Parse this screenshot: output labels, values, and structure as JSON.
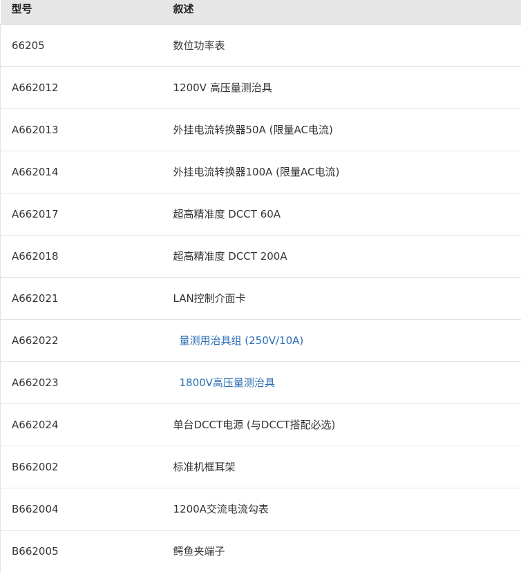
{
  "table": {
    "headers": {
      "model": "型号",
      "description": "叙述"
    },
    "rows": [
      {
        "model": "66205",
        "description": "数位功率表",
        "link": false
      },
      {
        "model": "A662012",
        "description": "1200V 高压量测治具",
        "link": false
      },
      {
        "model": "A662013",
        "description": "外挂电流转换器50A (限量AC电流)",
        "link": false
      },
      {
        "model": "A662014",
        "description": "外挂电流转换器100A (限量AC电流)",
        "link": false
      },
      {
        "model": "A662017",
        "description": "超高精准度 DCCT 60A",
        "link": false
      },
      {
        "model": "A662018",
        "description": "超高精准度 DCCT 200A",
        "link": false
      },
      {
        "model": "A662021",
        "description": "LAN控制介面卡",
        "link": false
      },
      {
        "model": "A662022",
        "description": "量测用治具组 (250V/10A)",
        "link": true
      },
      {
        "model": "A662023",
        "description": "1800V高压量测治具",
        "link": true
      },
      {
        "model": "A662024",
        "description": "单台DCCT电源 (与DCCT搭配必选)",
        "link": false
      },
      {
        "model": "B662002",
        "description": "标准机框耳架",
        "link": false
      },
      {
        "model": "B662004",
        "description": "1200A交流电流勾表",
        "link": false
      },
      {
        "model": "B662005",
        "description": "鳄鱼夹端子",
        "link": false
      }
    ]
  },
  "colors": {
    "header_bg": "#e6e6e6",
    "link": "#2a6db5",
    "text": "#333333",
    "border": "#e3e3e3"
  }
}
